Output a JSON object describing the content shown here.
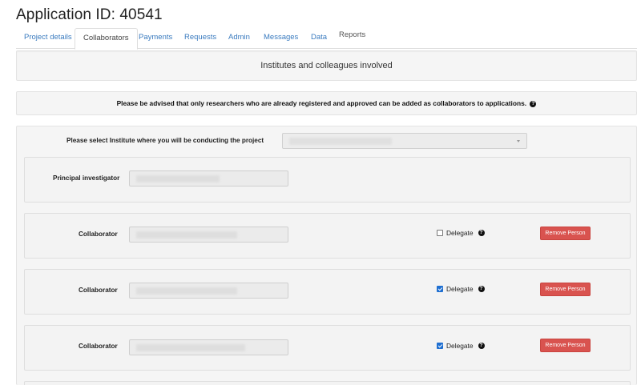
{
  "app_title": "Application ID: 40541",
  "tabs": [
    {
      "label": "Project details"
    },
    {
      "label": "Collaborators"
    },
    {
      "label": "Payments"
    },
    {
      "label": "Requests"
    },
    {
      "label": "Admin"
    },
    {
      "label": "Messages"
    },
    {
      "label": "Data"
    },
    {
      "label": "Reports"
    }
  ],
  "active_tab": "Collaborators",
  "section_title": "Institutes and colleagues involved",
  "notice": "Please be advised that only researchers who are already registered and approved can be added as collaborators to applications.",
  "institute": {
    "label": "Please select Institute where you will be conducting the project",
    "value": ""
  },
  "principal_investigator": {
    "label": "Principal investigator",
    "value": ""
  },
  "collaborators": [
    {
      "label": "Collaborator",
      "value": "",
      "delegate_label": "Delegate",
      "delegate_checked": false,
      "remove_label": "Remove Person"
    },
    {
      "label": "Collaborator",
      "value": "",
      "delegate_label": "Delegate",
      "delegate_checked": true,
      "remove_label": "Remove Person"
    },
    {
      "label": "Collaborator",
      "value": "",
      "delegate_label": "Delegate",
      "delegate_checked": true,
      "remove_label": "Remove Person"
    }
  ],
  "icons": {
    "help": "question-circle-icon",
    "select_caret": "caret-down-icon"
  },
  "colors": {
    "link": "#3a7bbf",
    "danger": "#d9534f",
    "checkbox": "#1f6fd1"
  }
}
